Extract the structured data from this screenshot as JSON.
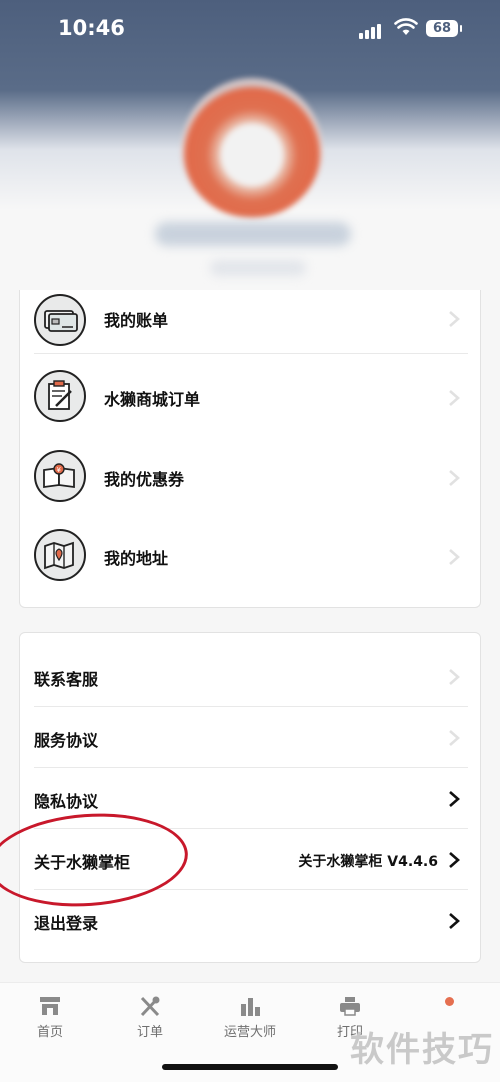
{
  "status_bar": {
    "time": "10:46",
    "battery": "68"
  },
  "menu_group_1": {
    "items": [
      {
        "label": "我的账单",
        "icon": "bank-card-icon"
      },
      {
        "label": "水獭商城订单",
        "icon": "order-pad-icon"
      },
      {
        "label": "我的优惠券",
        "icon": "coupon-book-icon"
      },
      {
        "label": "我的地址",
        "icon": "map-pin-icon"
      }
    ]
  },
  "menu_group_2": {
    "items": [
      {
        "label": "联系客服"
      },
      {
        "label": "服务协议"
      },
      {
        "label": "隐私协议"
      },
      {
        "label": "关于水獭掌柜",
        "value": "关于水獭掌柜 V4.4.6"
      },
      {
        "label": "退出登录"
      }
    ]
  },
  "tabbar": {
    "tabs": [
      {
        "label": "首页",
        "icon": "store-icon"
      },
      {
        "label": "订单",
        "icon": "utensils-icon"
      },
      {
        "label": "运营大师",
        "icon": "bar-chart-icon"
      },
      {
        "label": "打印",
        "icon": "printer-icon"
      }
    ]
  },
  "watermark": "软件技巧",
  "colors": {
    "header": "#4d5f7d",
    "accent": "#e56f50",
    "annotation": "#c8182b"
  }
}
